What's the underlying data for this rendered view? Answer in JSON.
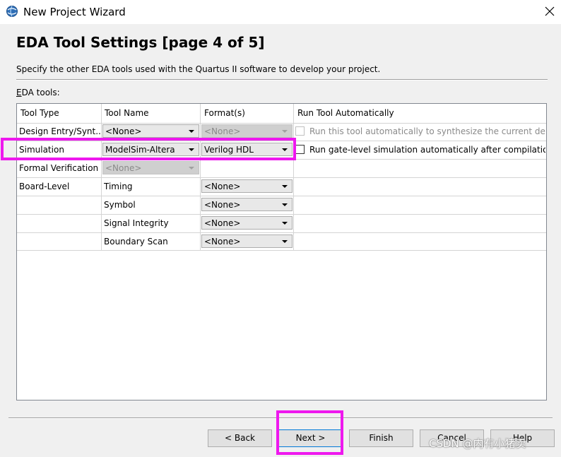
{
  "window": {
    "title": "New Project Wizard",
    "icon": "quartus-globe-icon",
    "close_icon": "close-icon"
  },
  "header": {
    "title": "EDA Tool Settings [page 4 of 5]",
    "description": "Specify the other EDA tools used with the Quartus II software to develop your project."
  },
  "eda_tools_label_prefix": "E",
  "eda_tools_label_rest": "DA tools:",
  "table": {
    "columns": [
      "Tool Type",
      "Tool Name",
      "Format(s)",
      "Run Tool Automatically"
    ],
    "rows": [
      {
        "tool_type": "Design Entry/Synt...",
        "tool_name": "<None>",
        "format": "<None>",
        "run_auto": "Run this tool automatically to synthesize the current design"
      },
      {
        "tool_type": "Simulation",
        "tool_name": "ModelSim-Altera",
        "format": "Verilog HDL",
        "run_auto": "Run gate-level simulation automatically after compilation"
      },
      {
        "tool_type": "Formal Verification",
        "tool_name": "<None>"
      },
      {
        "tool_type": "Board-Level",
        "tool_name": "Timing",
        "format": "<None>"
      },
      {
        "tool_type": "",
        "tool_name": "Symbol",
        "format": "<None>"
      },
      {
        "tool_type": "",
        "tool_name": "Signal Integrity",
        "format": "<None>"
      },
      {
        "tool_type": "",
        "tool_name": "Boundary Scan",
        "format": "<None>"
      }
    ]
  },
  "buttons": {
    "back": "< Back",
    "next": "Next >",
    "finish": "Finish",
    "cancel": "Cancel",
    "help": "Help"
  },
  "watermark": "CSDN @内有小猪卖",
  "highlight_color": "#ee18ee"
}
